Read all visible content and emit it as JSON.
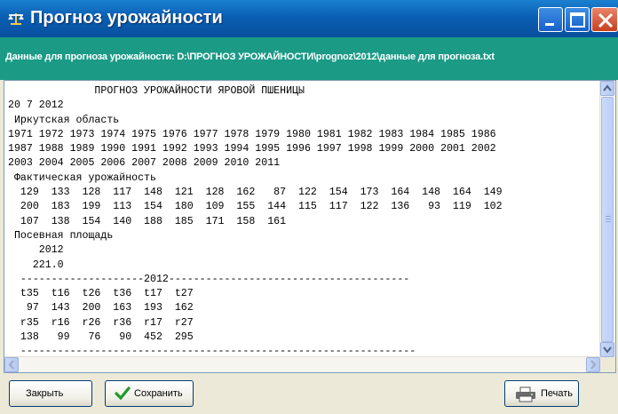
{
  "window": {
    "title": "Прогноз урожайности"
  },
  "info": {
    "label": "Данные для прогноза урожайности: D:\\ПРОГНОЗ УРОЖАЙНОСТИ\\prognoz\\2012\\данные для прогноза.txt"
  },
  "report": {
    "lines": [
      "              ПРОГНОЗ УРОЖАЙНОСТИ ЯРОВОЙ ПШЕНИЦЫ",
      "20 7 2012",
      " Иркутская область",
      "1971 1972 1973 1974 1975 1976 1977 1978 1979 1980 1981 1982 1983 1984 1985 1986",
      "1987 1988 1989 1990 1991 1992 1993 1994 1995 1996 1997 1998 1999 2000 2001 2002",
      "2003 2004 2005 2006 2007 2008 2009 2010 2011",
      " Фактическая урожайность",
      "  129  133  128  117  148  121  128  162   87  122  154  173  164  148  164  149",
      "  200  183  199  113  154  180  109  155  144  115  117  122  136   93  119  102",
      "  107  138  154  140  188  185  171  158  161",
      " Посевная площадь",
      "     2012",
      "    221.0",
      "  --------------------2012---------------------------------------",
      "  t35  t16  t26  t36  t17  t27",
      "   97  143  200  163  193  162",
      "  r35  r16  r26  r36  r17  r27",
      "  138   99   76   90  452  295",
      "  ----------------------------------------------------------------"
    ]
  },
  "buttons": {
    "close_label": "Закрыть",
    "save_label": "Сохранить",
    "print_label": "Печать"
  },
  "colors": {
    "titlebar": "#0a5fb4",
    "infobar": "#1b9a86",
    "save_check": "#1f9a2a"
  },
  "icons": {
    "app": "scale-icon",
    "minimize": "minimize-icon",
    "maximize": "maximize-icon",
    "close": "close-icon",
    "save": "checkmark-icon",
    "print": "printer-icon"
  }
}
